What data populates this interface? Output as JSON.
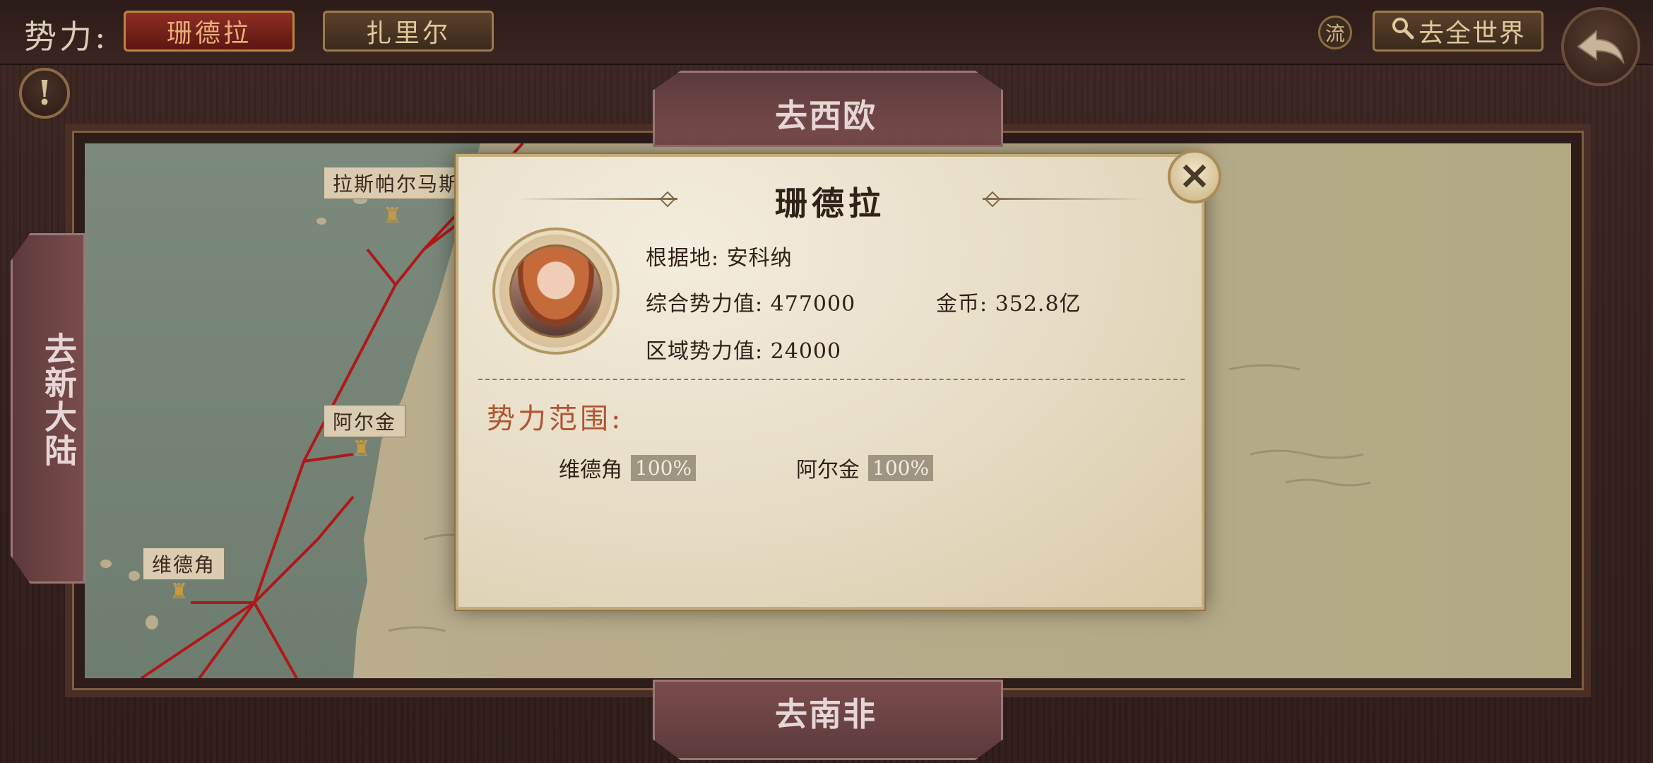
{
  "topbar": {
    "faction_label": "势力:",
    "tabs": [
      {
        "label": "珊德拉",
        "active": true
      },
      {
        "label": "扎里尔",
        "active": false
      }
    ],
    "liu_label": "流",
    "world_button_label": "去全世界",
    "world_button_icon": "search-icon",
    "back_icon": "back-arrow-icon"
  },
  "map": {
    "nav_top": "去西欧",
    "nav_bottom": "去南非",
    "nav_left": "去新大陆",
    "places": [
      {
        "name": "拉斯帕尔马斯"
      },
      {
        "name": "阿尔金"
      },
      {
        "name": "维德角"
      }
    ]
  },
  "popup": {
    "title": "珊德拉",
    "base_label": "根据地:",
    "base_value": "安科纳",
    "power_label": "综合势力值:",
    "power_value": "477000",
    "gold_label": "金币:",
    "gold_value": "352.8亿",
    "region_label": "区域势力值:",
    "region_value": "24000",
    "range_title": "势力范围:",
    "range": [
      {
        "name": "维德角",
        "percent": "100%"
      },
      {
        "name": "阿尔金",
        "percent": "100%"
      }
    ]
  },
  "colors": {
    "accent_red": "#8d2d24",
    "parchment": "#e6dcc4",
    "range_title": "#b15530",
    "route_red": "#b01818"
  }
}
